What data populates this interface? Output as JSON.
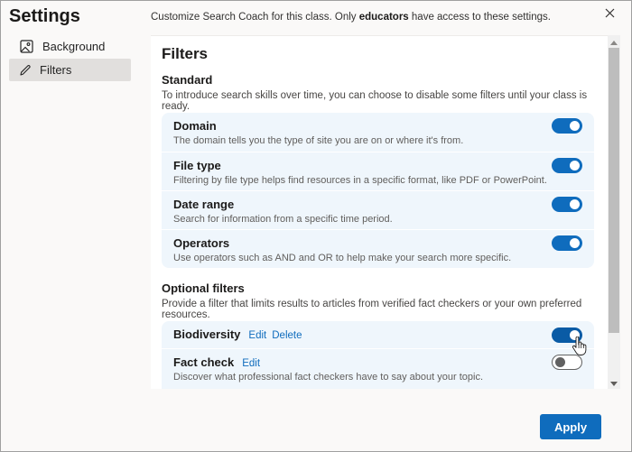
{
  "sidebar": {
    "title": "Settings",
    "items": [
      {
        "label": "Background",
        "icon": "image-icon",
        "selected": false
      },
      {
        "label": "Filters",
        "icon": "pencil-icon",
        "selected": true
      }
    ]
  },
  "header": {
    "text_before": "Customize Search Coach for this class. Only ",
    "text_bold": "educators",
    "text_after": " have access to these settings.",
    "close_icon": "close-icon"
  },
  "main": {
    "title": "Filters",
    "standard": {
      "heading": "Standard",
      "description": "To introduce search skills over time, you can choose to disable some filters until your class is ready.",
      "filters": [
        {
          "title": "Domain",
          "description": "The domain tells you the type of site you are on or where it's from.",
          "enabled": true
        },
        {
          "title": "File type",
          "description": "Filtering by file type helps find resources in a specific format, like PDF or PowerPoint.",
          "enabled": true
        },
        {
          "title": "Date range",
          "description": "Search for information from a specific time period.",
          "enabled": true
        },
        {
          "title": "Operators",
          "description": "Use operators such as AND and OR to help make your search more specific.",
          "enabled": true
        }
      ]
    },
    "optional": {
      "heading": "Optional filters",
      "description": "Provide a filter that limits results to articles from verified fact checkers or your own preferred resources.",
      "filters": [
        {
          "title": "Biodiversity",
          "description": "",
          "enabled": true,
          "edit_label": "Edit",
          "delete_label": "Delete"
        },
        {
          "title": "Fact check",
          "description": "Discover what professional fact checkers have to say about your topic.",
          "enabled": false,
          "edit_label": "Edit"
        }
      ]
    }
  },
  "footer": {
    "apply_label": "Apply"
  },
  "colors": {
    "accent": "#0f6cbd",
    "card_background": "#eff6fc",
    "window_background": "#faf9f8"
  }
}
